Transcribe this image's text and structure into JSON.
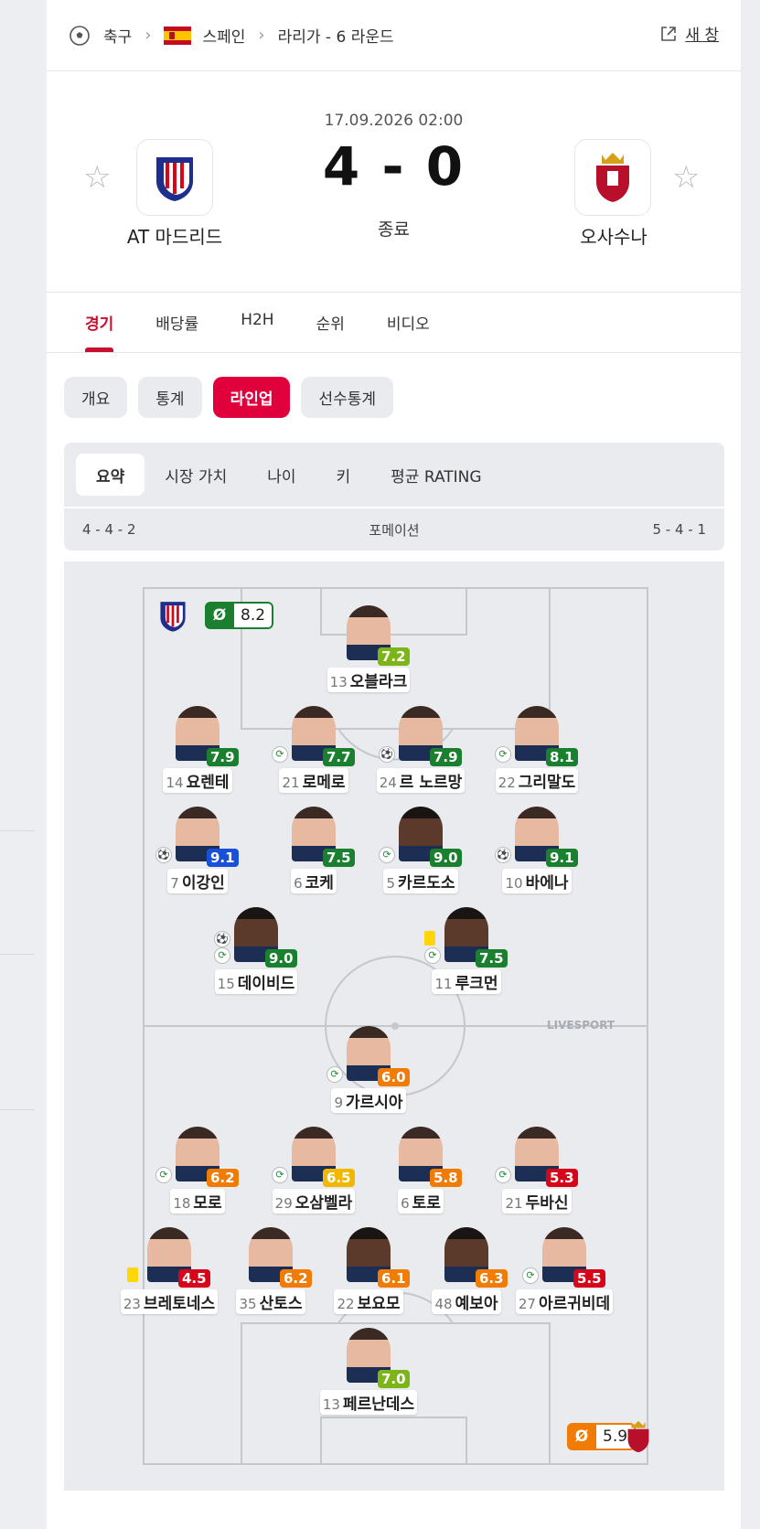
{
  "breadcrumb": {
    "sport": "축구",
    "country": "스페인",
    "league": "라리가 - 6 라운드",
    "new_window": "새 창"
  },
  "match": {
    "datetime": "17.09.2026 02:00",
    "score": "4 - 0",
    "status": "종료",
    "home": {
      "name": "AT 마드리드",
      "logo": "atletico-crest"
    },
    "away": {
      "name": "오사수나",
      "logo": "osasuna-crest"
    }
  },
  "tabs": [
    "경기",
    "배당률",
    "H2H",
    "순위",
    "비디오"
  ],
  "pills": [
    "개요",
    "통계",
    "라인업",
    "선수통계"
  ],
  "subtabs": [
    "요약",
    "시장 가치",
    "나이",
    "키",
    "평균 RATING"
  ],
  "formation": {
    "home": "4 - 4 - 2",
    "label": "포메이션",
    "away": "5 - 4 - 1"
  },
  "team_ratings": {
    "home": "8.2",
    "away": "5.9",
    "avg_icon": "Ø"
  },
  "watermark": "LIVESPORT",
  "colors": {
    "accent": "#e0003c",
    "rating_dark_green": "#1a7f2e",
    "rating_light_green": "#7cb518",
    "rating_orange": "#f07b05",
    "rating_red": "#d6051a",
    "rating_yellow": "#f0b800",
    "rating_blue": "#1a4fd8"
  },
  "players": [
    {
      "num": "13",
      "name": "오블라크",
      "rating": "7.2",
      "color": "#7cb518"
    },
    {
      "num": "14",
      "name": "요렌테",
      "rating": "7.9",
      "color": "#1a7f2e"
    },
    {
      "num": "21",
      "name": "로메로",
      "rating": "7.7",
      "color": "#1a7f2e"
    },
    {
      "num": "24",
      "name": "르 노르망",
      "rating": "7.9",
      "color": "#1a7f2e"
    },
    {
      "num": "22",
      "name": "그리말도",
      "rating": "8.1",
      "color": "#1a7f2e"
    },
    {
      "num": "7",
      "name": "이강인",
      "rating": "9.1",
      "color": "#1a4fd8"
    },
    {
      "num": "6",
      "name": "코케",
      "rating": "7.5",
      "color": "#1a7f2e"
    },
    {
      "num": "5",
      "name": "카르도소",
      "rating": "9.0",
      "color": "#1a7f2e"
    },
    {
      "num": "10",
      "name": "바에나",
      "rating": "9.1",
      "color": "#1a7f2e"
    },
    {
      "num": "15",
      "name": "데이비드",
      "rating": "9.0",
      "color": "#1a7f2e"
    },
    {
      "num": "11",
      "name": "루크먼",
      "rating": "7.5",
      "color": "#1a7f2e"
    },
    {
      "num": "9",
      "name": "가르시아",
      "rating": "6.0",
      "color": "#f07b05"
    },
    {
      "num": "18",
      "name": "모로",
      "rating": "6.2",
      "color": "#f07b05"
    },
    {
      "num": "29",
      "name": "오삼벨라",
      "rating": "6.5",
      "color": "#f0b800"
    },
    {
      "num": "6",
      "name": "토로",
      "rating": "5.8",
      "color": "#f07b05"
    },
    {
      "num": "21",
      "name": "두바신",
      "rating": "5.3",
      "color": "#d6051a"
    },
    {
      "num": "23",
      "name": "브레토네스",
      "rating": "4.5",
      "color": "#d6051a"
    },
    {
      "num": "35",
      "name": "산토스",
      "rating": "6.2",
      "color": "#f07b05"
    },
    {
      "num": "22",
      "name": "보요모",
      "rating": "6.1",
      "color": "#f07b05"
    },
    {
      "num": "48",
      "name": "예보아",
      "rating": "6.3",
      "color": "#f07b05"
    },
    {
      "num": "27",
      "name": "아르귀비데",
      "rating": "5.5",
      "color": "#d6051a"
    },
    {
      "num": "13",
      "name": "페르난데스",
      "rating": "7.0",
      "color": "#7cb518"
    }
  ]
}
